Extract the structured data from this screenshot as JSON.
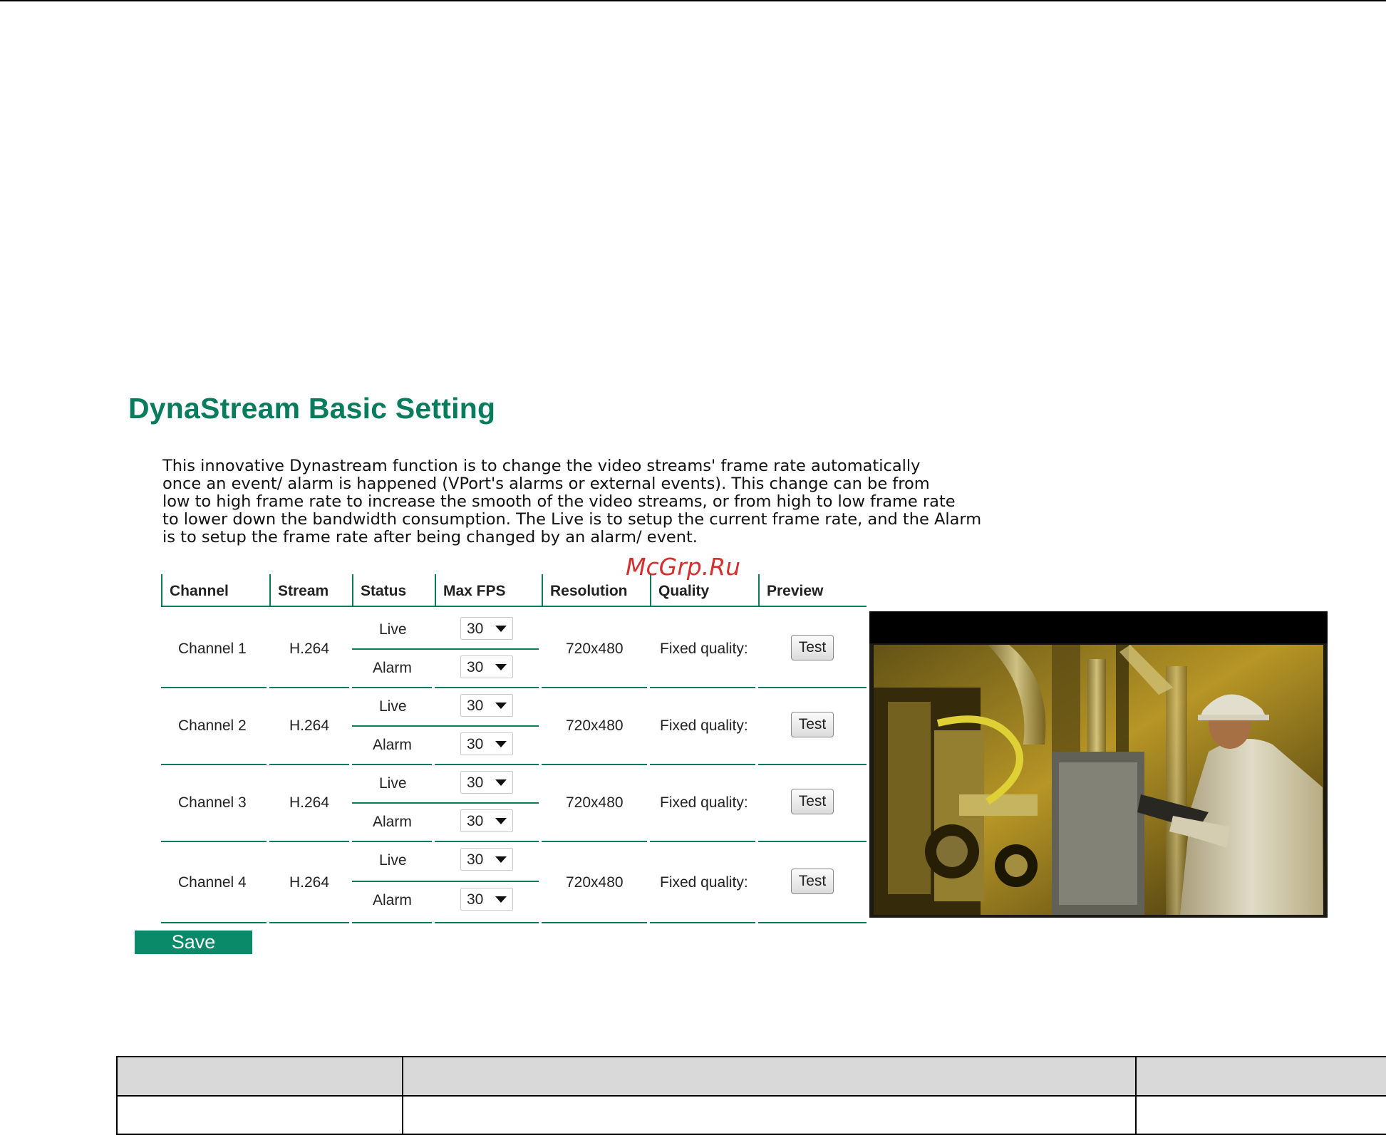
{
  "page": {
    "title": "DynaStream Basic Setting",
    "description": [
      "This innovative Dynastream function is to change the video streams' frame rate automatically",
      "once an event/ alarm is happened (VPort's alarms or external events). This change can be from",
      "low to high frame rate to increase the smooth of the video streams, or from high to low frame rate",
      "to lower down the bandwidth consumption. The Live is to setup the current frame rate, and the Alarm",
      "is to setup the frame rate after being changed by an alarm/ event."
    ],
    "watermark": "McGrp.Ru"
  },
  "table": {
    "headers": [
      "Channel",
      "Stream",
      "Status",
      "Max FPS",
      "Resolution",
      "Quality",
      "Preview"
    ],
    "rows": [
      {
        "channel": "Channel 1",
        "stream": "H.264",
        "live_label": "Live",
        "alarm_label": "Alarm",
        "live_fps": "30",
        "alarm_fps": "30",
        "resolution": "720x480",
        "quality": "Fixed quality:",
        "preview_button": "Test"
      },
      {
        "channel": "Channel 2",
        "stream": "H.264",
        "live_label": "Live",
        "alarm_label": "Alarm",
        "live_fps": "30",
        "alarm_fps": "30",
        "resolution": "720x480",
        "quality": "Fixed quality:",
        "preview_button": "Test"
      },
      {
        "channel": "Channel 3",
        "stream": "H.264",
        "live_label": "Live",
        "alarm_label": "Alarm",
        "live_fps": "30",
        "alarm_fps": "30",
        "resolution": "720x480",
        "quality": "Fixed quality:",
        "preview_button": "Test"
      },
      {
        "channel": "Channel 4",
        "stream": "H.264",
        "live_label": "Live",
        "alarm_label": "Alarm",
        "live_fps": "30",
        "alarm_fps": "30",
        "resolution": "720x480",
        "quality": "Fixed quality:",
        "preview_button": "Test"
      }
    ]
  },
  "save_label": "Save",
  "colors": {
    "accent": "#0a7c5e",
    "save_button": "#0a8a68",
    "watermark": "#d43030"
  },
  "icons": {
    "select_arrow": "chevron-down-icon"
  }
}
